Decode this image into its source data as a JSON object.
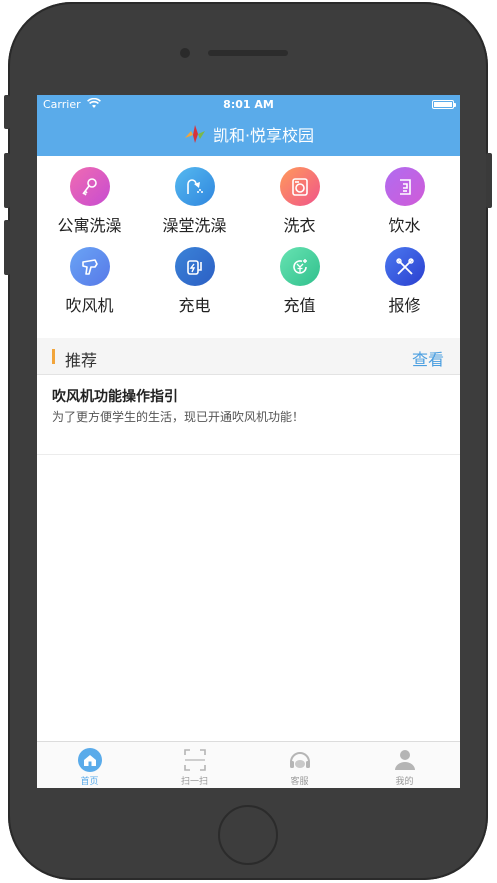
{
  "status": {
    "carrier": "Carrier",
    "time": "8:01 AM"
  },
  "nav": {
    "title": "凯和·悦享校园"
  },
  "services": [
    {
      "label": "公寓洗澡",
      "icon": "shower-key-icon",
      "color_from": "#f06bb1",
      "color_to": "#c74cd1"
    },
    {
      "label": "澡堂洗澡",
      "icon": "shower-head-icon",
      "color_from": "#56b9f0",
      "color_to": "#2f86de"
    },
    {
      "label": "洗衣",
      "icon": "washing-machine-icon",
      "color_from": "#ff9a5a",
      "color_to": "#f0558a"
    },
    {
      "label": "饮水",
      "icon": "water-dispenser-icon",
      "color_from": "#b06cf0",
      "color_to": "#d05bd8"
    },
    {
      "label": "吹风机",
      "icon": "hair-dryer-icon",
      "color_from": "#6aa4f5",
      "color_to": "#5779e8"
    },
    {
      "label": "充电",
      "icon": "charging-icon",
      "color_from": "#3b83d8",
      "color_to": "#2c5fc4"
    },
    {
      "label": "充值",
      "icon": "recharge-coin-icon",
      "color_from": "#67e3b2",
      "color_to": "#31c08d"
    },
    {
      "label": "报修",
      "icon": "repair-tools-icon",
      "color_from": "#4b79f0",
      "color_to": "#2a3fcf"
    }
  ],
  "recommend": {
    "title": "推荐",
    "more_label": "查看",
    "articles": [
      {
        "title": "吹风机功能操作指引",
        "summary": "为了更方便学生的生活，现已开通吹风机功能！"
      }
    ]
  },
  "tabbar": {
    "accent": "#5aabea",
    "tabs": [
      {
        "label": "首页",
        "icon": "home-icon",
        "active": true
      },
      {
        "label": "扫一扫",
        "icon": "scan-icon",
        "active": false
      },
      {
        "label": "客服",
        "icon": "customer-service-icon",
        "active": false
      },
      {
        "label": "我的",
        "icon": "profile-icon",
        "active": false
      }
    ]
  }
}
